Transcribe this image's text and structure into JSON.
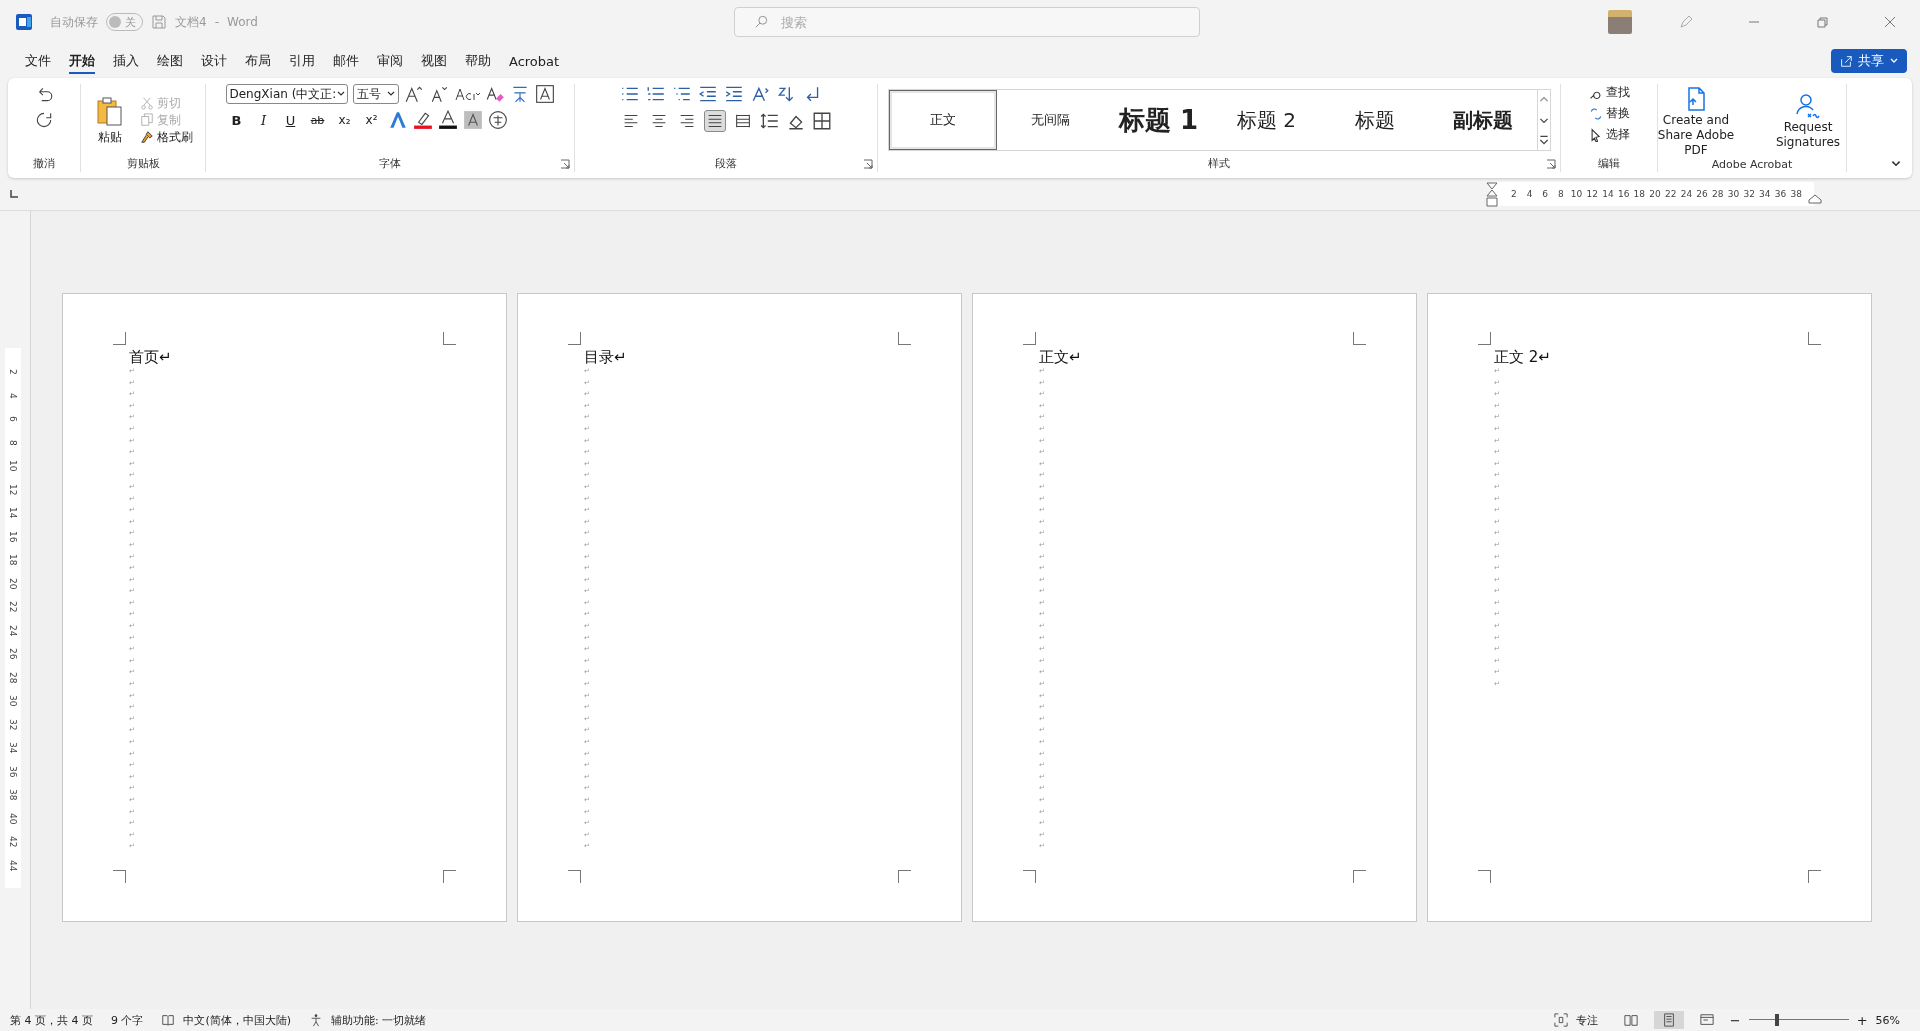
{
  "title_bar": {
    "autosave_label": "自动保存",
    "autosave_toggle": {
      "label": "关",
      "on": false
    },
    "doc_title": "文档4",
    "separator": "-",
    "app_name": "Word",
    "search": {
      "placeholder": "搜索"
    }
  },
  "menu_tabs": [
    {
      "label": "文件",
      "selected": false
    },
    {
      "label": "开始",
      "selected": true
    },
    {
      "label": "插入",
      "selected": false
    },
    {
      "label": "绘图",
      "selected": false
    },
    {
      "label": "设计",
      "selected": false
    },
    {
      "label": "布局",
      "selected": false
    },
    {
      "label": "引用",
      "selected": false
    },
    {
      "label": "邮件",
      "selected": false
    },
    {
      "label": "审阅",
      "selected": false
    },
    {
      "label": "视图",
      "selected": false
    },
    {
      "label": "帮助",
      "selected": false
    },
    {
      "label": "Acrobat",
      "selected": false
    }
  ],
  "share_button": "共享",
  "ribbon": {
    "undo_group": {
      "label": "撤消"
    },
    "clipboard": {
      "paste": "粘贴",
      "cut": "剪切",
      "copy": "复制",
      "format_painter": "格式刷",
      "label": "剪贴板"
    },
    "font": {
      "font_name": "DengXian (中文正:",
      "font_size": "五号",
      "label": "字体",
      "format_buttons": [
        {
          "kind": "bold",
          "glyph": "B"
        },
        {
          "kind": "italic",
          "glyph": "I"
        },
        {
          "kind": "underline",
          "glyph": "U"
        },
        {
          "kind": "strike",
          "glyph": "ab"
        },
        {
          "kind": "sub",
          "glyph": "x₂"
        },
        {
          "kind": "sup",
          "glyph": "x²"
        }
      ]
    },
    "paragraph": {
      "label": "段落",
      "alignments": [
        {
          "kind": "left",
          "selected": false
        },
        {
          "kind": "center",
          "selected": false
        },
        {
          "kind": "right",
          "selected": false
        },
        {
          "kind": "justify",
          "selected": true
        },
        {
          "kind": "distributed",
          "selected": false
        }
      ]
    },
    "styles": {
      "label": "样式",
      "items": [
        {
          "label": "正文",
          "kind": "body",
          "selected": true
        },
        {
          "label": "无间隔",
          "kind": "no-spacing",
          "selected": false
        },
        {
          "label": "标题 1",
          "kind": "heading1",
          "selected": false
        },
        {
          "label": "标题 2",
          "kind": "heading2",
          "selected": false
        },
        {
          "label": "标题",
          "kind": "title",
          "selected": false
        },
        {
          "label": "副标题",
          "kind": "subtitle",
          "selected": false
        }
      ]
    },
    "editing": {
      "label": "编辑",
      "items": [
        {
          "label": "查找",
          "kind": "find"
        },
        {
          "label": "替换",
          "kind": "replace"
        },
        {
          "label": "选择",
          "kind": "select"
        }
      ]
    },
    "acrobat": {
      "label": "Adobe Acrobat",
      "items": [
        {
          "label": "Create and Share Adobe PDF",
          "kind": "pdf"
        },
        {
          "label": "Request Signatures",
          "kind": "sign"
        }
      ]
    }
  },
  "rulers": {
    "horizontal": [
      "2",
      "4",
      "6",
      "8",
      "10",
      "12",
      "14",
      "16",
      "18",
      "20",
      "22",
      "24",
      "26",
      "28",
      "30",
      "32",
      "34",
      "36",
      "38"
    ],
    "vertical": [
      "2",
      "4",
      "6",
      "8",
      "10",
      "12",
      "14",
      "16",
      "18",
      "20",
      "22",
      "24",
      "26",
      "28",
      "30",
      "32",
      "34",
      "36",
      "38",
      "40",
      "42",
      "44"
    ]
  },
  "pages": [
    {
      "heading": "首页↵",
      "paragraph_marks": [
        "↵",
        "↵",
        "↵",
        "↵",
        "↵",
        "↵",
        "↵",
        "↵",
        "↵",
        "↵",
        "↵",
        "↵",
        "↵",
        "↵",
        "↵",
        "↵",
        "↵",
        "↵",
        "↵",
        "↵",
        "↵",
        "↵",
        "↵",
        "↵",
        "↵",
        "↵",
        "↵",
        "↵",
        "↵",
        "↵",
        "↵",
        "↵",
        "↵",
        "↵",
        "↵",
        "↵",
        "↵",
        "↵",
        "↵",
        "↵",
        "↵",
        "↵"
      ]
    },
    {
      "heading": "目录↵",
      "paragraph_marks": [
        "↵",
        "↵",
        "↵",
        "↵",
        "↵",
        "↵",
        "↵",
        "↵",
        "↵",
        "↵",
        "↵",
        "↵",
        "↵",
        "↵",
        "↵",
        "↵",
        "↵",
        "↵",
        "↵",
        "↵",
        "↵",
        "↵",
        "↵",
        "↵",
        "↵",
        "↵",
        "↵",
        "↵",
        "↵",
        "↵",
        "↵",
        "↵",
        "↵",
        "↵",
        "↵",
        "↵",
        "↵",
        "↵",
        "↵",
        "↵",
        "↵",
        "↵"
      ]
    },
    {
      "heading": "正文↵",
      "paragraph_marks": [
        "↵",
        "↵",
        "↵",
        "↵",
        "↵",
        "↵",
        "↵",
        "↵",
        "↵",
        "↵",
        "↵",
        "↵",
        "↵",
        "↵",
        "↵",
        "↵",
        "↵",
        "↵",
        "↵",
        "↵",
        "↵",
        "↵",
        "↵",
        "↵",
        "↵",
        "↵",
        "↵",
        "↵",
        "↵",
        "↵",
        "↵",
        "↵",
        "↵",
        "↵",
        "↵",
        "↵",
        "↵",
        "↵",
        "↵",
        "↵",
        "↵",
        "↵"
      ]
    },
    {
      "heading": "正文 2↵",
      "paragraph_marks": [
        "↵",
        "↵",
        "↵",
        "↵",
        "↵",
        "↵",
        "↵",
        "↵",
        "↵",
        "↵",
        "↵",
        "↵",
        "↵",
        "↵",
        "↵",
        "↵",
        "↵",
        "↵",
        "↵",
        "↵",
        "↵",
        "↵",
        "↵",
        "↵",
        "↵",
        "↵",
        "↵",
        "↵"
      ]
    }
  ],
  "status_bar": {
    "page": "第 4 页，共 4 页",
    "words": "9 个字",
    "language": "中文(简体，中国大陆)",
    "accessibility": "辅助功能: 一切就绪",
    "focus": "专注",
    "zoom_out": "−",
    "zoom_in": "+",
    "zoom": "56%",
    "zoom_slider": {
      "level": 0.28
    }
  }
}
